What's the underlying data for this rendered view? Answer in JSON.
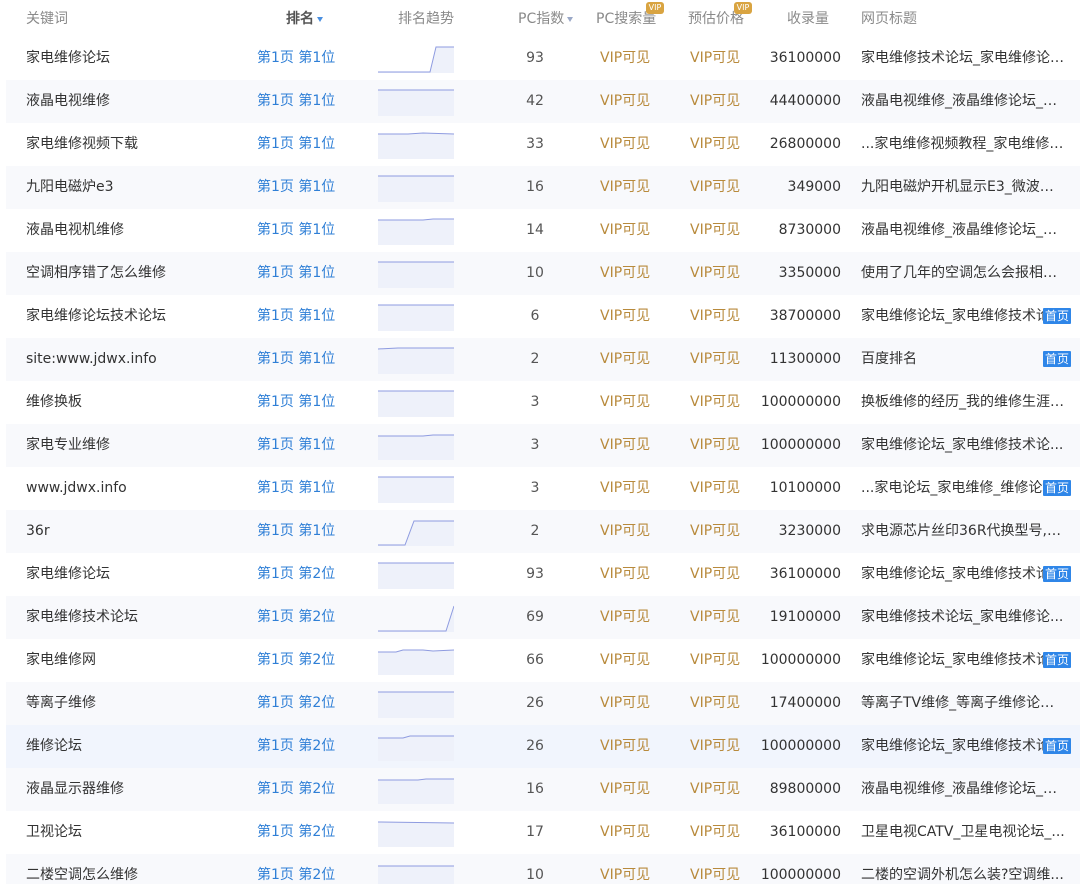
{
  "header": {
    "keyword": "关键词",
    "rank": "排名",
    "trend": "排名趋势",
    "pc_index": "PC指数",
    "pc_search": "PC搜索量",
    "price": "预估价格",
    "indexed": "收录量",
    "page_title": "网页标题",
    "vip_badge": "VIP"
  },
  "colors": {
    "link": "#2f7fd6",
    "vip": "#b88a3c",
    "badge": "#2f86e8",
    "trend_line": "#8e9be0"
  },
  "rows": [
    {
      "keyword": "家电维修论坛",
      "rank": "第1页 第1位",
      "pc": "93",
      "vip1": "VIP可见",
      "vip2": "VIP可见",
      "indexed": "36100000",
      "title": "家电维修技术论坛_家电维修论坛...",
      "badge": ""
    },
    {
      "keyword": "液晶电视维修",
      "rank": "第1页 第1位",
      "pc": "42",
      "vip1": "VIP可见",
      "vip2": "VIP可见",
      "indexed": "44400000",
      "title": "液晶电视维修_液晶维修论坛_液...",
      "badge": ""
    },
    {
      "keyword": "家电维修视频下载",
      "rank": "第1页 第1位",
      "pc": "33",
      "vip1": "VIP可见",
      "vip2": "VIP可见",
      "indexed": "26800000",
      "title": "...家电维修视频教程_家电维修视...",
      "badge": ""
    },
    {
      "keyword": "九阳电磁炉e3",
      "rank": "第1页 第1位",
      "pc": "16",
      "vip1": "VIP可见",
      "vip2": "VIP可见",
      "indexed": "349000",
      "title": "九阳电磁炉开机显示E3_微波炉...",
      "badge": ""
    },
    {
      "keyword": "液晶电视机维修",
      "rank": "第1页 第1位",
      "pc": "14",
      "vip1": "VIP可见",
      "vip2": "VIP可见",
      "indexed": "8730000",
      "title": "液晶电视维修_液晶维修论坛_液...",
      "badge": ""
    },
    {
      "keyword": "空调相序错了怎么维修",
      "rank": "第1页 第1位",
      "pc": "10",
      "vip1": "VIP可见",
      "vip2": "VIP可见",
      "indexed": "3350000",
      "title": "使用了几年的空调怎么会报相序...",
      "badge": ""
    },
    {
      "keyword": "家电维修论坛技术论坛",
      "rank": "第1页 第1位",
      "pc": "6",
      "vip1": "VIP可见",
      "vip2": "VIP可见",
      "indexed": "38700000",
      "title": "家电维修论坛_家电维修技术论",
      "badge": "首页"
    },
    {
      "keyword": "site:www.jdwx.info",
      "rank": "第1页 第1位",
      "pc": "2",
      "vip1": "VIP可见",
      "vip2": "VIP可见",
      "indexed": "11300000",
      "title": "百度排名",
      "badge": "首页"
    },
    {
      "keyword": "维修换板",
      "rank": "第1页 第1位",
      "pc": "3",
      "vip1": "VIP可见",
      "vip2": "VIP可见",
      "indexed": "100000000",
      "title": "换板维修的经历_我的维修生涯_...",
      "badge": ""
    },
    {
      "keyword": "家电专业维修",
      "rank": "第1页 第1位",
      "pc": "3",
      "vip1": "VIP可见",
      "vip2": "VIP可见",
      "indexed": "100000000",
      "title": "家电维修论坛_家电维修技术论...",
      "badge": ""
    },
    {
      "keyword": "www.jdwx.info",
      "rank": "第1页 第1位",
      "pc": "3",
      "vip1": "VIP可见",
      "vip2": "VIP可见",
      "indexed": "10100000",
      "title": "...家电论坛_家电维修_维修论坛",
      "badge": "首页"
    },
    {
      "keyword": "36r",
      "rank": "第1页 第1位",
      "pc": "2",
      "vip1": "VIP可见",
      "vip2": "VIP可见",
      "indexed": "3230000",
      "title": "求电源芯片丝印36R代换型号,_...",
      "badge": ""
    },
    {
      "keyword": "家电维修论坛",
      "rank": "第1页 第2位",
      "pc": "93",
      "vip1": "VIP可见",
      "vip2": "VIP可见",
      "indexed": "36100000",
      "title": "家电维修论坛_家电维修技术论",
      "badge": "首页"
    },
    {
      "keyword": "家电维修技术论坛",
      "rank": "第1页 第2位",
      "pc": "69",
      "vip1": "VIP可见",
      "vip2": "VIP可见",
      "indexed": "19100000",
      "title": "家电维修技术论坛_家电维修论...",
      "badge": ""
    },
    {
      "keyword": "家电维修网",
      "rank": "第1页 第2位",
      "pc": "66",
      "vip1": "VIP可见",
      "vip2": "VIP可见",
      "indexed": "100000000",
      "title": "家电维修论坛_家电维修技术论",
      "badge": "首页"
    },
    {
      "keyword": "等离子维修",
      "rank": "第1页 第2位",
      "pc": "26",
      "vip1": "VIP可见",
      "vip2": "VIP可见",
      "indexed": "17400000",
      "title": "等离子TV维修_等离子维修论坛_...",
      "badge": ""
    },
    {
      "keyword": "维修论坛",
      "rank": "第1页 第2位",
      "pc": "26",
      "vip1": "VIP可见",
      "vip2": "VIP可见",
      "indexed": "100000000",
      "title": "家电维修论坛_家电维修技术论",
      "badge": "首页"
    },
    {
      "keyword": "液晶显示器维修",
      "rank": "第1页 第2位",
      "pc": "16",
      "vip1": "VIP可见",
      "vip2": "VIP可见",
      "indexed": "89800000",
      "title": "液晶电视维修_液晶维修论坛_液...",
      "badge": ""
    },
    {
      "keyword": "卫视论坛",
      "rank": "第1页 第2位",
      "pc": "17",
      "vip1": "VIP可见",
      "vip2": "VIP可见",
      "indexed": "36100000",
      "title": "卫星电视CATV_卫星电视论坛_...",
      "badge": ""
    },
    {
      "keyword": "二楼空调怎么维修",
      "rank": "第1页 第2位",
      "pc": "10",
      "vip1": "VIP可见",
      "vip2": "VIP可见",
      "indexed": "100000000",
      "title": "二楼的空调外机怎么装?空调维...",
      "badge": ""
    }
  ]
}
